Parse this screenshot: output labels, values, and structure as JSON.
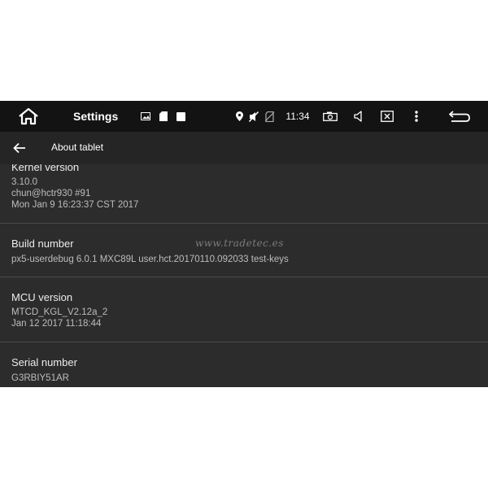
{
  "status_bar": {
    "title": "Settings",
    "time": "11:34",
    "icons": [
      "home-icon",
      "image-icon",
      "sd-card-icon",
      "square-icon",
      "location-pin-icon",
      "mute-icon",
      "no-sim-icon",
      "camera-icon",
      "volume-icon",
      "close-window-icon",
      "more-vert-icon",
      "back-return-icon"
    ]
  },
  "app_bar": {
    "title": "About tablet",
    "back_icon": "arrow-left-icon"
  },
  "items": [
    {
      "label": "Kernel version",
      "values": [
        "3.10.0",
        "chun@hctr930 #91",
        "Mon Jan 9 16:23:37 CST 2017"
      ]
    },
    {
      "label": "Build number",
      "values": [
        "px5-userdebug 6.0.1 MXC89L user.hct.20170110.092033 test-keys"
      ]
    },
    {
      "label": "MCU version",
      "values": [
        "MTCD_KGL_V2.12a_2",
        "Jan 12 2017  11:18:44"
      ]
    },
    {
      "label": "Serial number",
      "values": [
        "G3RBIY51AR"
      ]
    }
  ],
  "watermark": "www.tradetec.es",
  "colors": {
    "status_bar_bg": "#131313",
    "app_bar_bg": "#252525",
    "content_bg": "#2c2c2c",
    "divider": "#4a4a4a",
    "primary_text": "#ececec",
    "secondary_text": "#bdbdbd"
  }
}
